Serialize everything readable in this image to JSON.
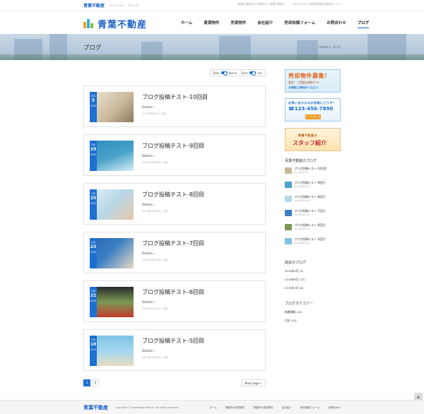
{
  "top": {
    "logo": "青葉不動産",
    "hours1": "TEL 03-xxx",
    "hours2": "PM 9:00",
    "tagline": "青葉区青葉台の不動産なら青葉不動産へ",
    "contact": "〒000-0000 東京都青葉区青葉台1-2-3"
  },
  "header": {
    "logo": "青葉不動産",
    "nav": [
      "ホーム",
      "賃貸物件",
      "売買物件",
      "会社紹介",
      "売却依頼フォーム",
      "お問合わせ",
      "ブログ"
    ]
  },
  "banner": {
    "title": "ブログ",
    "breadcrumb": "Home > ブログ"
  },
  "sort": {
    "date": "Date",
    "name": "Name",
    "desc": "Desc",
    "asc": "Asc"
  },
  "posts": [
    {
      "month": "6月",
      "day": "5",
      "year": "2015",
      "title": "ブログ投稿テスト-10回目",
      "details": "Details »",
      "meta": "2015年6月5日 / 日記",
      "color": "#c9b89a"
    },
    {
      "month": "5月",
      "day": "29",
      "year": "2015",
      "title": "ブログ投稿テスト-9回目",
      "details": "Details »",
      "meta": "2015年5月29日 / 日記",
      "color": "#4aa3c9"
    },
    {
      "month": "5月",
      "day": "25",
      "year": "2015",
      "title": "ブログ投稿テスト-8回目",
      "details": "Details »",
      "meta": "2015年5月25日 / 日記",
      "color": "#b8d7e8"
    },
    {
      "month": "5月",
      "day": "23",
      "year": "2015",
      "title": "ブログ投稿テスト-7回目",
      "details": "Details »",
      "meta": "2015年5月23日 / 日記",
      "color": "#3b7fc4"
    },
    {
      "month": "5月",
      "day": "21",
      "year": "2015",
      "title": "ブログ投稿テスト-6回目",
      "details": "Details »",
      "meta": "2015年5月21日 / 日記",
      "color": "#7a9a55"
    },
    {
      "month": "5月",
      "day": "18",
      "year": "2015",
      "title": "ブログ投稿テスト-5回目",
      "details": "Details »",
      "meta": "2015年5月18日 / 日記",
      "color": "#7fc3e6"
    }
  ],
  "pager": {
    "pages": [
      "1",
      "2"
    ],
    "next": "Next page »"
  },
  "sidebar": {
    "ad1": {
      "title": "売却物件募集！",
      "sub": "査定・ご相談は無料です",
      "cta": "お気軽にお問合せください"
    },
    "ad2": {
      "top": "お問い合わせはお気軽にどうぞ!",
      "tel": "☎123-456-7890",
      "btn": "メールはこちら"
    },
    "ad3": {
      "top": "青葉不動産の",
      "main": "スタッフ紹介"
    },
    "recent_title": "青葉不動産のブログ",
    "recent": [
      {
        "title": "ブログ投稿テスト-10回目",
        "date": "2015年6月5日",
        "color": "#c9b89a"
      },
      {
        "title": "ブログ投稿テスト-9回目",
        "date": "2015年5月29日",
        "color": "#4aa3c9"
      },
      {
        "title": "ブログ投稿テスト-8回目",
        "date": "2015年5月25日",
        "color": "#b8d7e8"
      },
      {
        "title": "ブログ投稿テスト-7回目",
        "date": "2015年5月23日",
        "color": "#3b7fc4"
      },
      {
        "title": "ブログ投稿テスト-6回目",
        "date": "2015年5月21日",
        "color": "#7a9a55"
      },
      {
        "title": "ブログ投稿テスト-5回目",
        "date": "2015年5月18日",
        "color": "#7fc3e6"
      }
    ],
    "archive_title": "過去のブログ",
    "archive": [
      "2015年5月 (2)",
      "2015年6月 (12)",
      "2015年7月 (6)"
    ],
    "cat_title": "ブログカテゴリー",
    "categories": [
      "新着情報 (10)",
      "日記 (10)"
    ]
  },
  "footer": {
    "logo": "青葉不動産",
    "copy": "Copyright © HomePage Vehicle. All rights reserved.",
    "nav": [
      "ホーム",
      "青葉市の売買物件",
      "青葉市の賃貸物件",
      "会社紹介",
      "売却依頼フォーム",
      "お問合わせ"
    ]
  },
  "colors": {
    "accent": "#1d6fd1",
    "brand": "#1d63c3"
  }
}
